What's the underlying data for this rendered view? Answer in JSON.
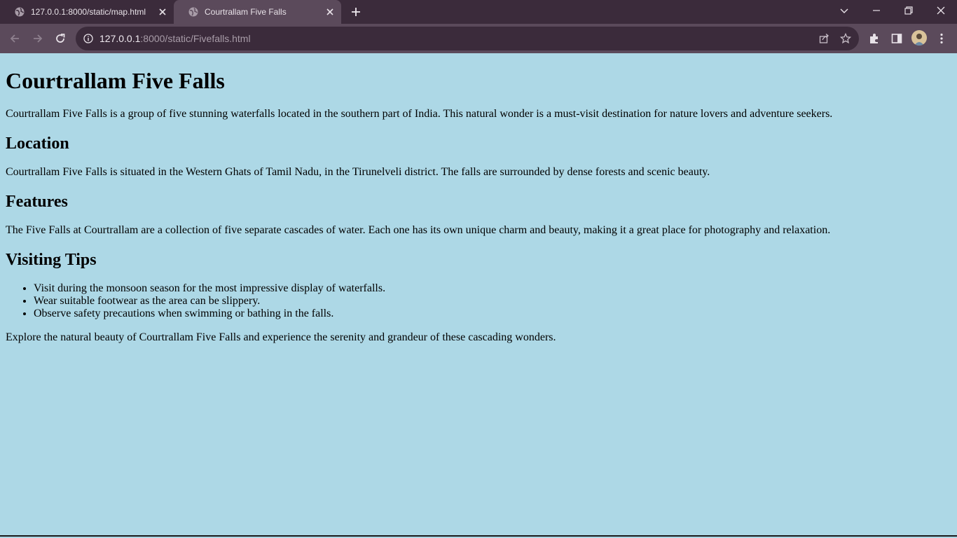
{
  "browser": {
    "tabs": [
      {
        "title": "127.0.0.1:8000/static/map.html",
        "active": false
      },
      {
        "title": "Courtrallam Five Falls",
        "active": true
      }
    ],
    "url_host": "127.0.0.1",
    "url_rest": ":8000/static/Fivefalls.html",
    "colors": {
      "tabstrip": "#3b2b3b",
      "toolbar": "#5b4a5b",
      "page_bg": "#add8e6"
    }
  },
  "page": {
    "title": "Courtrallam Five Falls",
    "intro": "Courtrallam Five Falls is a group of five stunning waterfalls located in the southern part of India. This natural wonder is a must-visit destination for nature lovers and adventure seekers.",
    "location": {
      "heading": "Location",
      "text": "Courtrallam Five Falls is situated in the Western Ghats of Tamil Nadu, in the Tirunelveli district. The falls are surrounded by dense forests and scenic beauty."
    },
    "features": {
      "heading": "Features",
      "text": "The Five Falls at Courtrallam are a collection of five separate cascades of water. Each one has its own unique charm and beauty, making it a great place for photography and relaxation."
    },
    "tips": {
      "heading": "Visiting Tips",
      "items": [
        "Visit during the monsoon season for the most impressive display of waterfalls.",
        "Wear suitable footwear as the area can be slippery.",
        "Observe safety precautions when swimming or bathing in the falls."
      ]
    },
    "closing": "Explore the natural beauty of Courtrallam Five Falls and experience the serenity and grandeur of these cascading wonders."
  }
}
